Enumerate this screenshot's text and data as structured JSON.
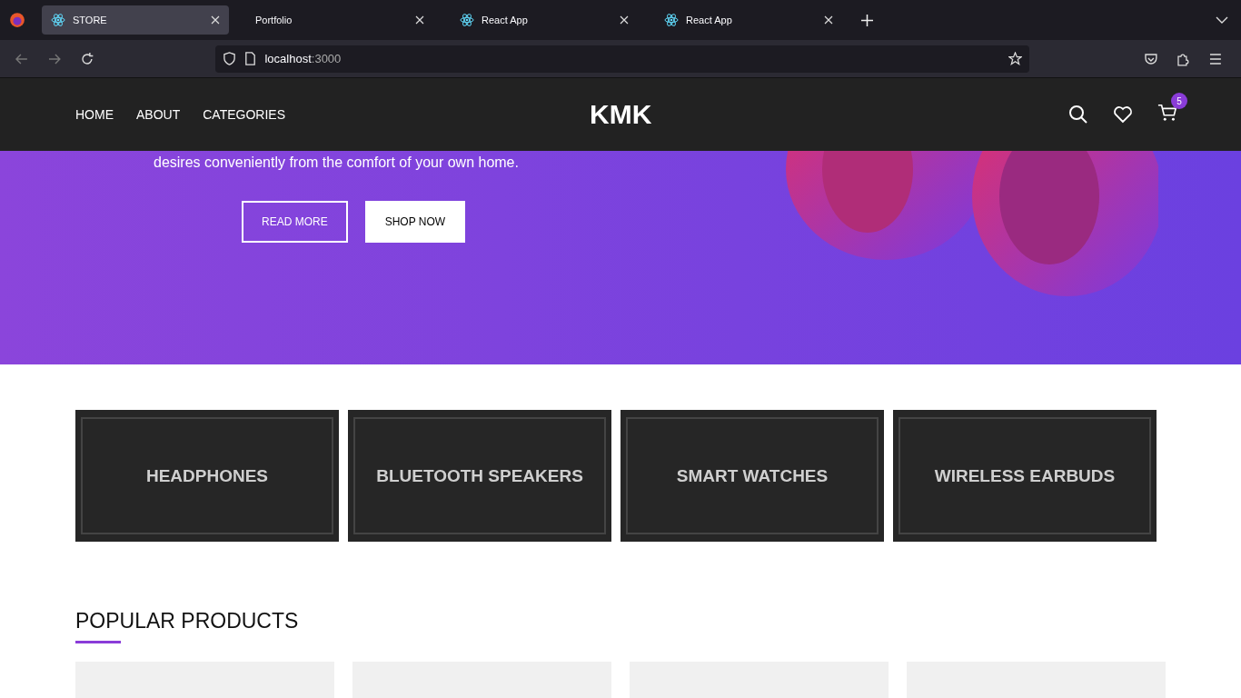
{
  "browser": {
    "tabs": [
      {
        "label": "STORE",
        "selected": true,
        "has_icon": true
      },
      {
        "label": "Portfolio",
        "selected": false,
        "has_icon": false
      },
      {
        "label": "React App",
        "selected": false,
        "has_icon": true
      },
      {
        "label": "React App",
        "selected": false,
        "has_icon": true
      }
    ],
    "url_host": "localhost",
    "url_port": ":3000"
  },
  "header": {
    "nav": [
      "HOME",
      "ABOUT",
      "CATEGORIES"
    ],
    "logo": "KMK",
    "cart_count": "5"
  },
  "hero": {
    "text": "desires conveniently from the comfort of your own home.",
    "buttons": [
      {
        "label": "READ MORE",
        "kind": "outline"
      },
      {
        "label": "SHOP NOW",
        "kind": "solid"
      }
    ]
  },
  "categories": [
    "HEADPHONES",
    "BLUETOOTH SPEAKERS",
    "SMART WATCHES",
    "WIRELESS EARBUDS"
  ],
  "popular": {
    "title": "POPULAR PRODUCTS"
  }
}
